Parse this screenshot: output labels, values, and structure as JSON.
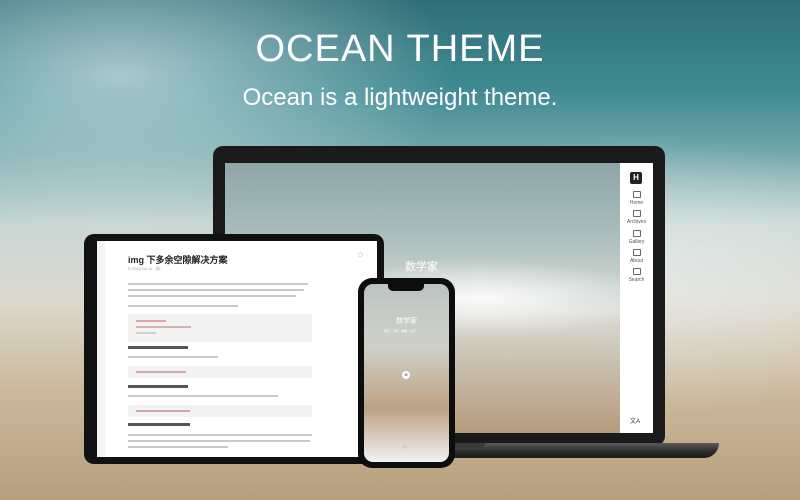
{
  "hero": {
    "title": "OCEAN THEME",
    "subtitle": "Ocean is a lightweight theme."
  },
  "laptop": {
    "brand": "数学家",
    "nav": {
      "logo": "H",
      "items": [
        "Home",
        "Archives",
        "Gallery",
        "About",
        "Search"
      ],
      "bottom": "文A"
    }
  },
  "tablet": {
    "post_title": "img 下多余空隙解决方案",
    "post_meta": "© 2021-08-11 · 阅"
  },
  "phone": {
    "brand": "数学家",
    "subtitle": "首页 · 归档 · 相册 · 关于",
    "button": "⊕"
  },
  "colors": {
    "hero_text": "#ffffff",
    "device_frame": "#1a1a1a"
  }
}
